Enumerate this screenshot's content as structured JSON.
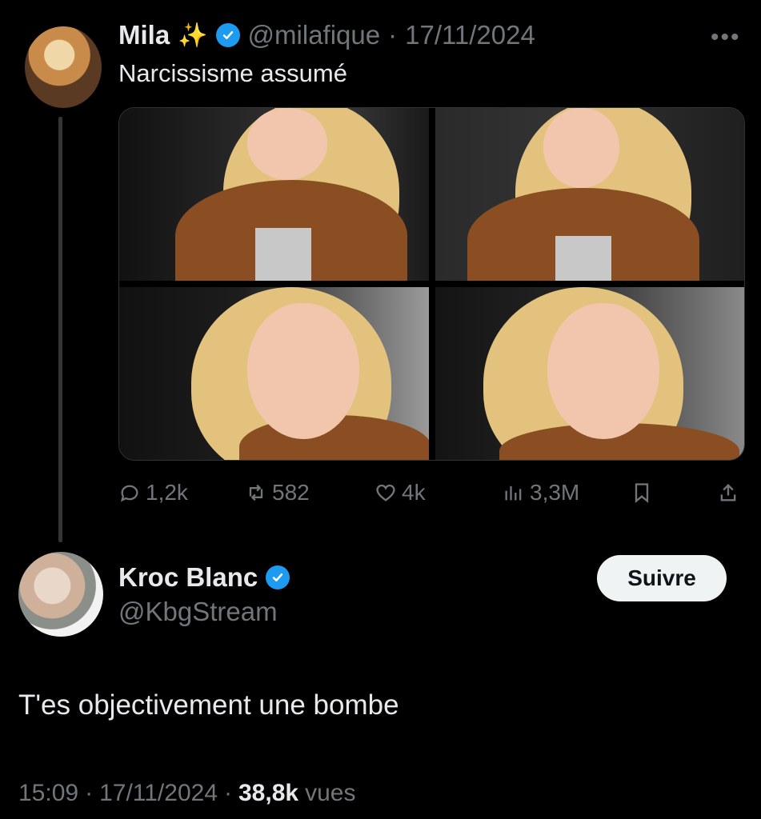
{
  "original_tweet": {
    "author_name": "Mila",
    "author_emoji": "✨",
    "handle": "@milafique",
    "separator": "·",
    "date": "17/11/2024",
    "more_label": "•••",
    "text": "Narcissisme assumé",
    "media_count": 4,
    "stats": {
      "replies": "1,2k",
      "reposts": "582",
      "likes": "4k",
      "views": "3,3M"
    }
  },
  "reply": {
    "author_name": "Kroc Blanc",
    "handle": "@KbgStream",
    "follow_label": "Suivre",
    "text": "T'es objectivement une bombe",
    "time": "15:09",
    "separator": "·",
    "date": "17/11/2024",
    "views_count": "38,8k",
    "views_label": "vues"
  },
  "colors": {
    "background": "#000000",
    "text": "#e7e9ea",
    "muted": "#71767b",
    "verified": "#1d9bf0",
    "follow_button_bg": "#eff3f4"
  }
}
